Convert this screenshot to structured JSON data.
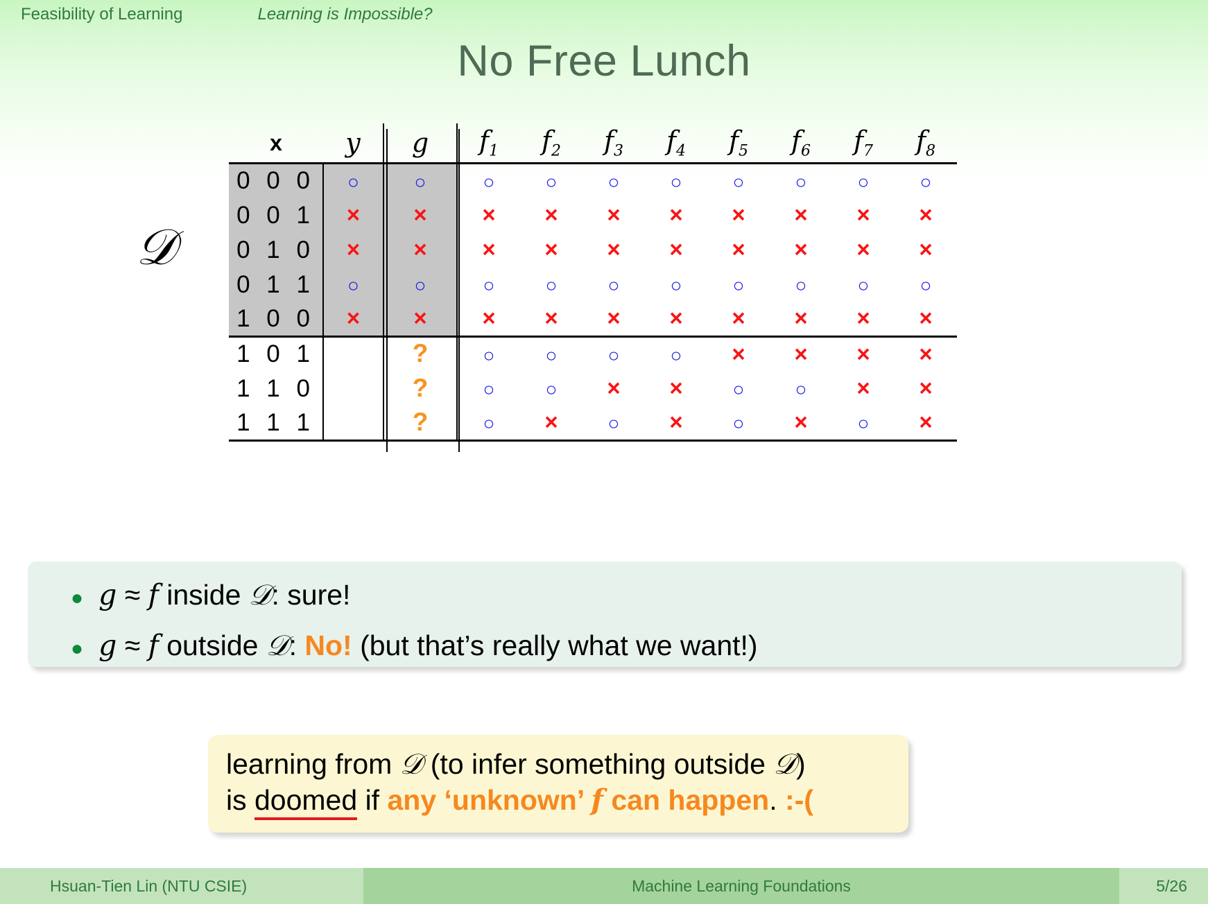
{
  "header": {
    "section": "Feasibility of Learning",
    "subsection": "Learning is Impossible?"
  },
  "title": "No Free Lunch",
  "dataset_label": "D",
  "table": {
    "headers": {
      "x": "x",
      "y": "y",
      "g": "g",
      "f": [
        "f",
        "f",
        "f",
        "f",
        "f",
        "f",
        "f",
        "f"
      ],
      "f_subs": [
        "1",
        "2",
        "3",
        "4",
        "5",
        "6",
        "7",
        "8"
      ]
    },
    "symbols": {
      "circle": "○",
      "cross": "×",
      "question": "?"
    },
    "rows": [
      {
        "x": "0 0 0",
        "y": "o",
        "g": "o",
        "f": [
          "o",
          "o",
          "o",
          "o",
          "o",
          "o",
          "o",
          "o"
        ],
        "in_D": true
      },
      {
        "x": "0 0 1",
        "y": "x",
        "g": "x",
        "f": [
          "x",
          "x",
          "x",
          "x",
          "x",
          "x",
          "x",
          "x"
        ],
        "in_D": true
      },
      {
        "x": "0 1 0",
        "y": "x",
        "g": "x",
        "f": [
          "x",
          "x",
          "x",
          "x",
          "x",
          "x",
          "x",
          "x"
        ],
        "in_D": true
      },
      {
        "x": "0 1 1",
        "y": "o",
        "g": "o",
        "f": [
          "o",
          "o",
          "o",
          "o",
          "o",
          "o",
          "o",
          "o"
        ],
        "in_D": true
      },
      {
        "x": "1 0 0",
        "y": "x",
        "g": "x",
        "f": [
          "x",
          "x",
          "x",
          "x",
          "x",
          "x",
          "x",
          "x"
        ],
        "in_D": true
      },
      {
        "x": "1 0 1",
        "y": "",
        "g": "q",
        "f": [
          "o",
          "o",
          "o",
          "o",
          "x",
          "x",
          "x",
          "x"
        ],
        "in_D": false
      },
      {
        "x": "1 1 0",
        "y": "",
        "g": "q",
        "f": [
          "o",
          "o",
          "x",
          "x",
          "o",
          "o",
          "x",
          "x"
        ],
        "in_D": false
      },
      {
        "x": "1 1 1",
        "y": "",
        "g": "q",
        "f": [
          "o",
          "x",
          "o",
          "x",
          "o",
          "x",
          "o",
          "x"
        ],
        "in_D": false
      }
    ]
  },
  "bullets": [
    {
      "parts": [
        {
          "t": "g",
          "s": "it"
        },
        {
          "t": " ≈ ",
          "s": "plain"
        },
        {
          "t": "f",
          "s": "it"
        },
        {
          "t": " inside ",
          "s": "plain"
        },
        {
          "t": "D",
          "s": "cal"
        },
        {
          "t": ": sure!",
          "s": "plain"
        }
      ]
    },
    {
      "parts": [
        {
          "t": "g",
          "s": "it"
        },
        {
          "t": " ≈ ",
          "s": "plain"
        },
        {
          "t": "f",
          "s": "it"
        },
        {
          "t": " outside ",
          "s": "plain"
        },
        {
          "t": "D",
          "s": "cal"
        },
        {
          "t": ": ",
          "s": "plain"
        },
        {
          "t": "No!",
          "s": "orange-bold"
        },
        {
          "t": " (but that’s really what we want!)",
          "s": "plain"
        }
      ]
    }
  ],
  "callout": {
    "line1": [
      {
        "t": "learning from ",
        "s": "plain"
      },
      {
        "t": "D",
        "s": "cal"
      },
      {
        "t": " (to infer something outside ",
        "s": "plain"
      },
      {
        "t": "D",
        "s": "cal"
      },
      {
        "t": ")",
        "s": "plain"
      }
    ],
    "line2": [
      {
        "t": "is ",
        "s": "plain"
      },
      {
        "t": "doomed",
        "s": "underline-red"
      },
      {
        "t": " if ",
        "s": "plain"
      },
      {
        "t": "any ‘unknown’ ",
        "s": "orange-bold"
      },
      {
        "t": "f",
        "s": "orange-bold-it"
      },
      {
        "t": " can happen",
        "s": "orange-bold"
      },
      {
        "t": ". ",
        "s": "plain"
      },
      {
        "t": ":-(",
        "s": "orange-bold"
      }
    ]
  },
  "footer": {
    "author": "Hsuan-Tien Lin  (NTU CSIE)",
    "course": "Machine Learning Foundations",
    "page": "5/26"
  },
  "colors": {
    "accent_green": "#2f7a3f",
    "title_gray": "#4e6b56",
    "circle_blue": "#1414e8",
    "cross_red": "#fa1414",
    "question_orange": "#f79421",
    "highlight_orange": "#f6881f",
    "shade_gray": "#c6c6c6",
    "panel_green": "#e8f2ec",
    "callout_yellow": "#fcf7d2"
  }
}
